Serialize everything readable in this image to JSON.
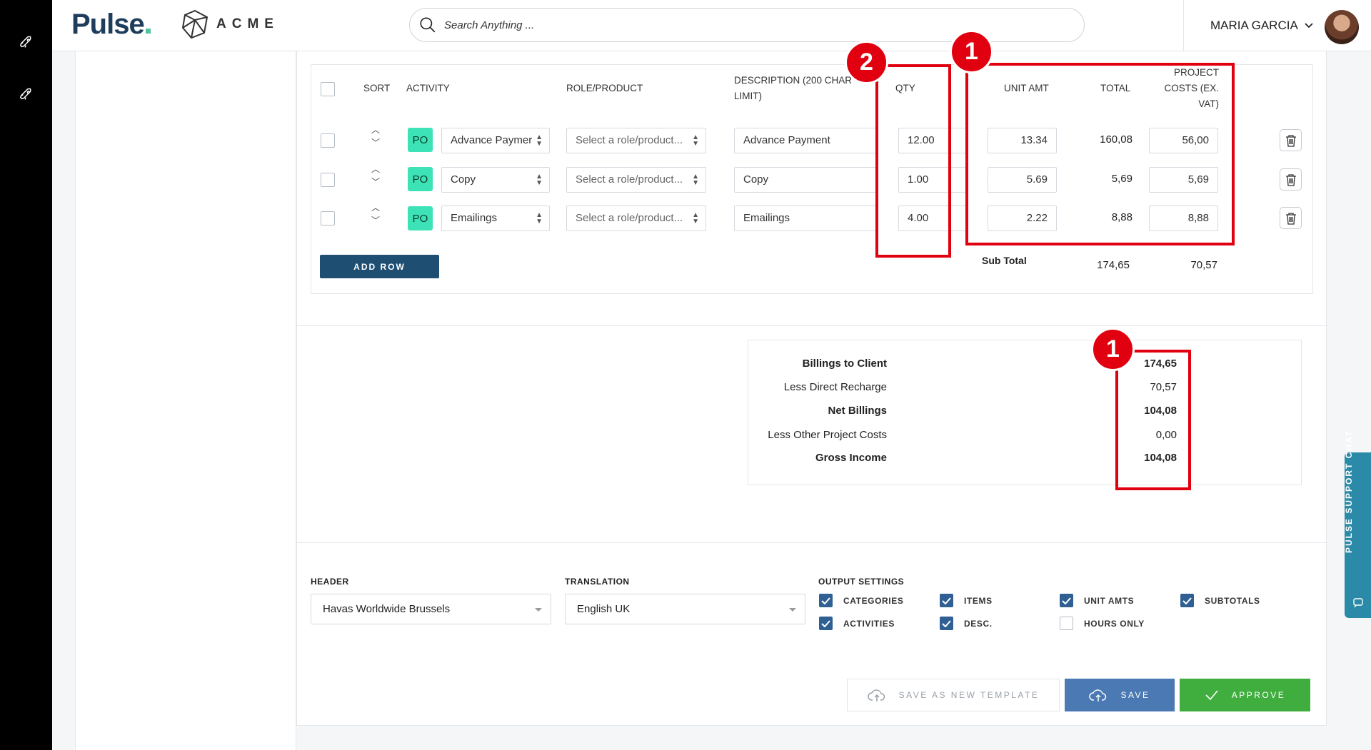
{
  "app": {
    "logo": "Pulse",
    "client_logo": "ACME",
    "search_placeholder": "Search Anything ...",
    "user_name": "MARIA GARCIA"
  },
  "table": {
    "headers": {
      "sort": "SORT",
      "activity": "ACTIVITY",
      "role": "ROLE/PRODUCT",
      "description": "DESCRIPTION (200 CHAR LIMIT)",
      "qty": "QTY",
      "unit_amt": "UNIT AMT",
      "total": "TOTAL",
      "project_costs": "PROJECT COSTS (EX. VAT)"
    },
    "rows": [
      {
        "tag": "PO",
        "activity": "Advance Paymer",
        "role": "Select a role/product...",
        "description": "Advance Payment",
        "qty": "12.00",
        "unit_amt": "13.34",
        "total": "160,08",
        "project_costs": "56,00"
      },
      {
        "tag": "PO",
        "activity": "Copy",
        "role": "Select a role/product...",
        "description": "Copy",
        "qty": "1.00",
        "unit_amt": "5.69",
        "total": "5,69",
        "project_costs": "5,69"
      },
      {
        "tag": "PO",
        "activity": "Emailings",
        "role": "Select a role/product...",
        "description": "Emailings",
        "qty": "4.00",
        "unit_amt": "2.22",
        "total": "8,88",
        "project_costs": "8,88"
      }
    ],
    "add_row": "ADD ROW",
    "subtotal_label": "Sub Total",
    "subtotal_total": "174,65",
    "subtotal_costs": "70,57"
  },
  "summary": [
    {
      "label": "Billings to Client",
      "value": "174,65",
      "bold": true
    },
    {
      "label": "Less Direct Recharge",
      "value": "70,57",
      "bold": false
    },
    {
      "label": "Net Billings",
      "value": "104,08",
      "bold": true
    },
    {
      "label": "Less Other Project Costs",
      "value": "0,00",
      "bold": false
    },
    {
      "label": "Gross Income",
      "value": "104,08",
      "bold": true
    }
  ],
  "settings": {
    "header_label": "HEADER",
    "header_value": "Havas Worldwide Brussels",
    "translation_label": "TRANSLATION",
    "translation_value": "English UK",
    "output_label": "OUTPUT SETTINGS",
    "options": [
      {
        "label": "CATEGORIES",
        "checked": true
      },
      {
        "label": "ITEMS",
        "checked": true
      },
      {
        "label": "UNIT AMTS",
        "checked": true
      },
      {
        "label": "SUBTOTALS",
        "checked": true
      },
      {
        "label": "ACTIVITIES",
        "checked": true
      },
      {
        "label": "DESC.",
        "checked": true
      },
      {
        "label": "HOURS ONLY",
        "checked": false
      }
    ]
  },
  "actions": {
    "save_template": "SAVE AS NEW TEMPLATE",
    "save": "SAVE",
    "approve": "APPROVE"
  },
  "annotations": {
    "badge_1": "1",
    "badge_2": "2",
    "badge_3": "1"
  },
  "support_chat": "PULSE SUPPORT CHAT",
  "colors": {
    "brand_navy": "#1e4f73",
    "po_tag": "#3de3b6",
    "approve": "#3fae3f",
    "save": "#4a79b3",
    "annotation_red": "#e10010"
  }
}
